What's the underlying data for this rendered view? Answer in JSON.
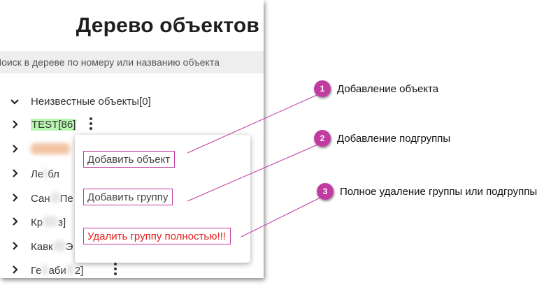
{
  "panel": {
    "title": "Дерево объектов",
    "search": {
      "placeholder": "Поиск в дереве по номеру или названию объекта"
    }
  },
  "tree": {
    "items": [
      {
        "label": "Неизвестные объекты[0]",
        "expanded": true
      },
      {
        "label": "TEST[86]",
        "highlight": "#b8f5b0"
      },
      {
        "label": ""
      },
      {
        "label": "Ле",
        "label_end": "бл"
      },
      {
        "label": "Сан",
        "label_end": "Пе"
      },
      {
        "label": "Кр",
        "label_end": "з]"
      },
      {
        "label": "Кавк",
        "label_end": "Э"
      },
      {
        "label": "Ге",
        "label_mid": "аби",
        "label_end": "2]"
      }
    ]
  },
  "context_menu": {
    "add_object": "Добавить объект",
    "add_group": "Добавить группу",
    "delete_group": "Удалить группу полностью!!!"
  },
  "callouts": [
    {
      "number": "1",
      "text": "Добавление объекта"
    },
    {
      "number": "2",
      "text": "Добавление подгруппы"
    },
    {
      "number": "3",
      "text": "Полное удаление группы или подгруппы"
    }
  ],
  "colors": {
    "accent": "#c23ba0",
    "danger": "#e62020",
    "highlight": "#b8f5b0",
    "search_bg": "#eeeeee"
  }
}
